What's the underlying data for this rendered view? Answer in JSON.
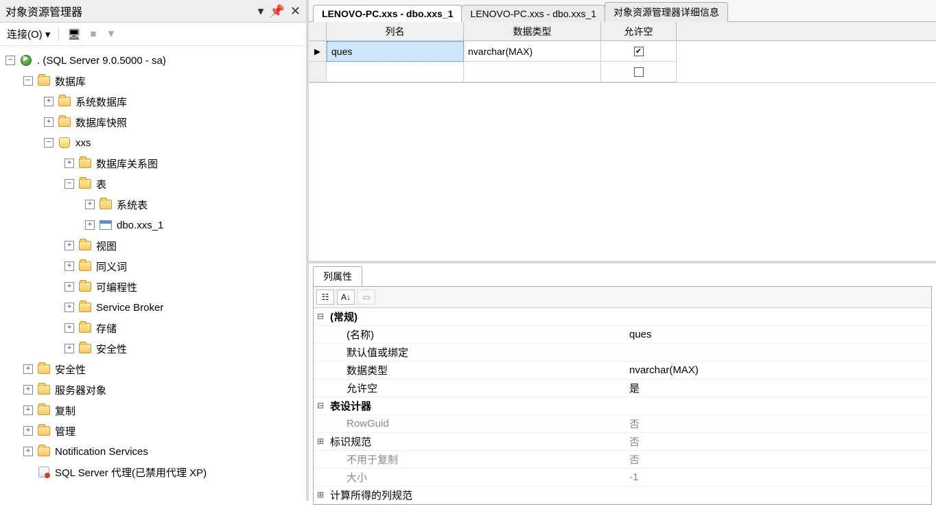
{
  "objectExplorer": {
    "title": "对象资源管理器",
    "connectLabel": "连接(O)",
    "server": ". (SQL Server 9.0.5000 - sa)",
    "nodes": {
      "databases": "数据库",
      "sysDatabases": "系统数据库",
      "dbSnapshots": "数据库快照",
      "dbName": "xxs",
      "dbDiagrams": "数据库关系图",
      "tables": "表",
      "sysTables": "系统表",
      "userTable": "dbo.xxs_1",
      "views": "视图",
      "synonyms": "同义词",
      "programmability": "可编程性",
      "serviceBroker": "Service Broker",
      "storage": "存储",
      "security": "安全性",
      "topSecurity": "安全性",
      "serverObjects": "服务器对象",
      "replication": "复制",
      "management": "管理",
      "notification": "Notification Services",
      "agent": "SQL Server 代理(已禁用代理 XP)"
    }
  },
  "tabs": {
    "t1": "LENOVO-PC.xxs - dbo.xxs_1",
    "t2": "LENOVO-PC.xxs - dbo.xxs_1",
    "t3": "对象资源管理器详细信息"
  },
  "designer": {
    "headers": {
      "colName": "列名",
      "dataType": "数据类型",
      "allowNull": "允许空"
    },
    "row1": {
      "name": "ques",
      "type": "nvarchar(MAX)",
      "allowNull": true
    }
  },
  "properties": {
    "tabLabel": "列属性",
    "groups": {
      "general": "(常规)",
      "name": "(名称)",
      "nameVal": "ques",
      "default": "默认值或绑定",
      "defaultVal": "",
      "dataType": "数据类型",
      "dataTypeVal": "nvarchar(MAX)",
      "allowNull": "允许空",
      "allowNullVal": "是",
      "designer": "表设计器",
      "rowGuid": "RowGuid",
      "rowGuidVal": "否",
      "identity": "标识规范",
      "identityVal": "否",
      "notForRepl": "不用于复制",
      "notForReplVal": "否",
      "size": "大小",
      "sizeVal": "-1",
      "computed": "计算所得的列规范"
    }
  }
}
